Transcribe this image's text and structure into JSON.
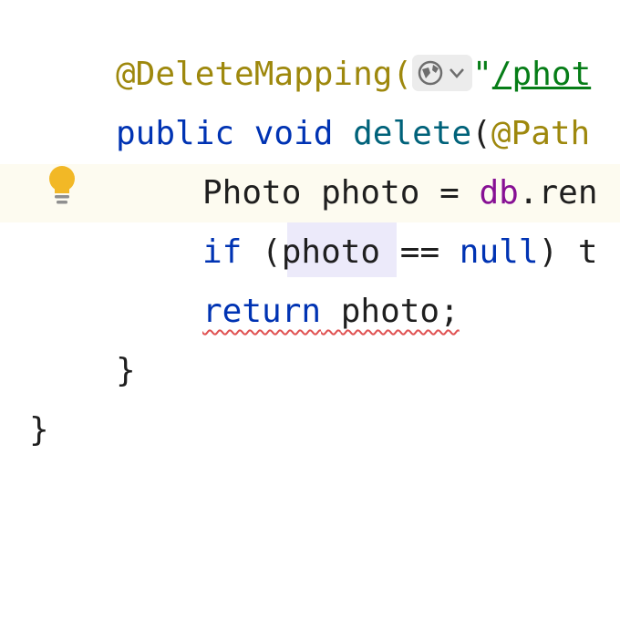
{
  "editor": {
    "lines": {
      "l1": {
        "annotation": "@DeleteMapping(",
        "icon": "globe-icon",
        "string_quote": "\"",
        "string_path": "/phot"
      },
      "l2": {
        "kw_public": "public",
        "kw_void": "void",
        "method_name": "delete",
        "rest": "(",
        "param_annotation": "@Path"
      },
      "l3": {
        "type": "Photo",
        "var": "photo",
        "assign": " = ",
        "field": "db",
        "rest": ".ren"
      },
      "l4": {
        "kw_if": "if",
        "cond_open": "(photo == ",
        "kw_null": "null",
        "cond_close": ") t"
      },
      "l5": {
        "kw_return": "return",
        "value": "photo;"
      },
      "l6": {
        "brace": "}"
      },
      "l7": {
        "brace": "}"
      }
    },
    "gutter": {
      "intention_icon": "lightbulb-icon"
    },
    "colors": {
      "keyword": "#0033b3",
      "annotation": "#9e880d",
      "method": "#00627a",
      "string": "#067d17",
      "field": "#871094",
      "bulb": "#f2b826",
      "current_line": "#fdfbf0",
      "error_underline": "#e05252"
    }
  }
}
